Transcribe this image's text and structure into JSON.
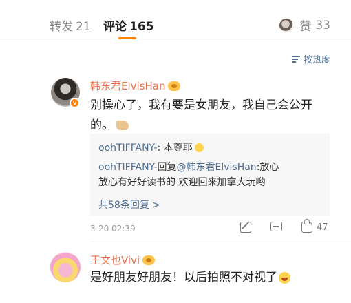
{
  "tabs": {
    "repost_label": "转发",
    "repost_count": "21",
    "comments_label": "评论",
    "comments_count": "165",
    "likes_label": "赞",
    "likes_count": "33"
  },
  "sort": {
    "label": "按热度",
    "icon": "sort-icon"
  },
  "comments": [
    {
      "user": "韩东君ElvisHan",
      "verified": true,
      "text_line1": "别操心了，我有要是女朋友，我自己会公开",
      "text_line2": "的。",
      "emoji": "hands-emoji",
      "replies": [
        {
          "user": "oohTIFFANY-",
          "text": ": 本尊耶"
        },
        {
          "user": "oohTIFFANY-",
          "reply_word": "回复",
          "mention": "@韩东君ElvisHan",
          "text": ":放心",
          "text_line2": "放心有好好读书的 欢迎回来加拿大玩哟"
        }
      ],
      "more_replies": "共58条回复 >",
      "time": "3-20 02:39",
      "like_count": "47"
    },
    {
      "user": "王文也Vivi",
      "text": "是好朋友好朋友！以后拍照不对视了",
      "emoji": "laugh-emoji"
    }
  ],
  "colors": {
    "accent": "#ff8200",
    "username": "#eb7350",
    "link": "#4f6f95"
  }
}
